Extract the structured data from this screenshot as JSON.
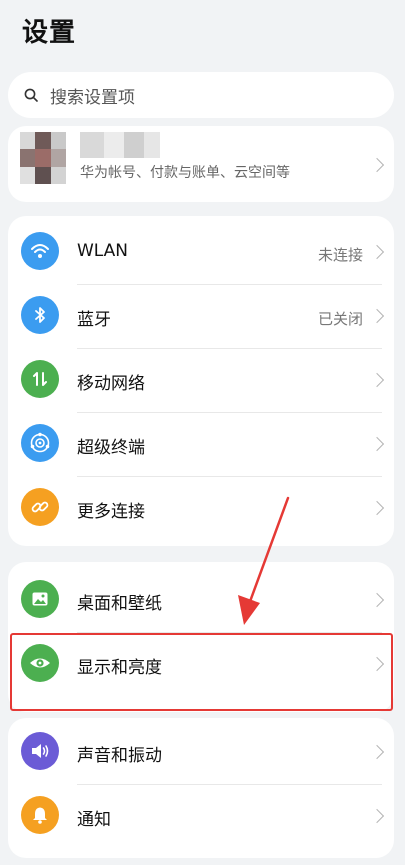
{
  "page": {
    "title": "设置"
  },
  "search": {
    "placeholder": "搜索设置项"
  },
  "account": {
    "subtitle": "华为帐号、付款与账单、云空间等"
  },
  "groups": [
    {
      "items": [
        {
          "label": "WLAN",
          "value": "未连接",
          "icon": "wifi-icon",
          "color": "#3b9cf0"
        },
        {
          "label": "蓝牙",
          "value": "已关闭",
          "icon": "bluetooth-icon",
          "color": "#3b9cf0"
        },
        {
          "label": "移动网络",
          "value": "",
          "icon": "mobile-data-icon",
          "color": "#4caf50"
        },
        {
          "label": "超级终端",
          "value": "",
          "icon": "super-device-icon",
          "color": "#3b9cf0"
        },
        {
          "label": "更多连接",
          "value": "",
          "icon": "link-icon",
          "color": "#f5a021"
        }
      ]
    },
    {
      "items": [
        {
          "label": "桌面和壁纸",
          "value": "",
          "icon": "wallpaper-icon",
          "color": "#4caf50"
        },
        {
          "label": "显示和亮度",
          "value": "",
          "icon": "eye-icon",
          "color": "#4caf50"
        }
      ]
    },
    {
      "items": [
        {
          "label": "声音和振动",
          "value": "",
          "icon": "speaker-icon",
          "color": "#6b5bd6"
        },
        {
          "label": "通知",
          "value": "",
          "icon": "bell-icon",
          "color": "#f5a021"
        }
      ]
    }
  ],
  "annotation": {
    "color": "#e53935"
  }
}
